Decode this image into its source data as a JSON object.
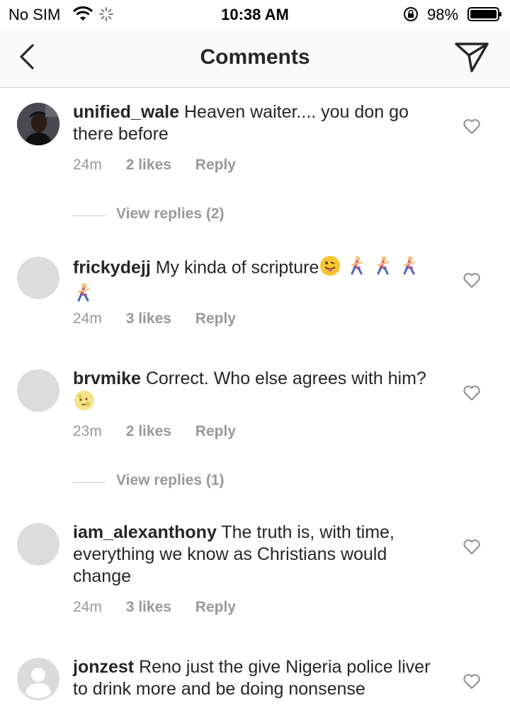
{
  "status_bar": {
    "carrier": "No SIM",
    "time": "10:38 AM",
    "battery_percent": "98%",
    "icons": [
      "wifi-icon",
      "loading-spinner-icon",
      "orientation-lock-icon",
      "battery-icon"
    ]
  },
  "header": {
    "title": "Comments",
    "back_icon": "chevron-left-icon",
    "share_icon": "paper-plane-icon"
  },
  "comments": [
    {
      "username": "unified_wale",
      "text": "Heaven waiter.... you don go there before",
      "time": "24m",
      "likes": "2 likes",
      "reply": "Reply",
      "avatar": "photo",
      "view_replies": "View replies (2)"
    },
    {
      "username": "frickydejj",
      "text": "My kinda of scripture",
      "emoji_suffix": [
        "tongue-face",
        "runner",
        "runner",
        "runner",
        "runner"
      ],
      "time": "24m",
      "likes": "3 likes",
      "reply": "Reply",
      "avatar": "blank"
    },
    {
      "username": "brvmike",
      "text": "Correct. Who else agrees with him?",
      "emoji_suffix": [
        "full-moon-face"
      ],
      "time": "23m",
      "likes": "2 likes",
      "reply": "Reply",
      "avatar": "blank",
      "view_replies": "View replies (1)"
    },
    {
      "username": "iam_alexanthony",
      "text": "The truth is, with time, everything we know as Christians would change",
      "time": "24m",
      "likes": "3 likes",
      "reply": "Reply",
      "avatar": "blank"
    },
    {
      "username": "jonzest",
      "text": "Reno just the give Nigeria police liver to drink more and be doing nonsense",
      "avatar": "default-person"
    }
  ],
  "colors": {
    "text": "#262626",
    "meta": "#999999",
    "header_bg": "#fafafa",
    "divider": "#d4d4d4"
  }
}
